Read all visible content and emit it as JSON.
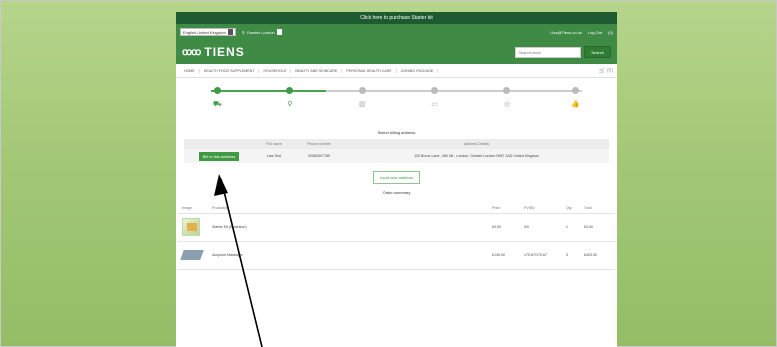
{
  "promo_bar": {
    "text": "Click here to purchase Starter kit"
  },
  "util_bar": {
    "language": "English United Kingdom",
    "region": "Greater London",
    "email": "Lisa@Tiens.co.uk",
    "logout": "Log Out",
    "cart_count": "(0)"
  },
  "header": {
    "brand": "TIENS",
    "search_placeholder": "Search store",
    "search_button": "Search"
  },
  "nav": {
    "items": [
      "HOME",
      "HEALTH FOOD SUPPLEMENT",
      "HOUSEHOLD",
      "BEAUTY AND SKINCARE",
      "PERSONAL HEALTH CARE",
      "JOINING PACKAGE"
    ],
    "cart_label": "(0)"
  },
  "checkout_steps": [
    {
      "icon": "cart-icon",
      "glyph": "⛟",
      "done": true
    },
    {
      "icon": "map-pin-icon",
      "glyph": "⚲",
      "done": true
    },
    {
      "icon": "shipping-icon",
      "glyph": "▥",
      "done": false
    },
    {
      "icon": "payment-icon",
      "glyph": "▭",
      "done": false
    },
    {
      "icon": "confirm-icon",
      "glyph": "◎",
      "done": false
    },
    {
      "icon": "thumbs-up-icon",
      "glyph": "👍",
      "done": false
    }
  ],
  "billing": {
    "title": "Select billing address",
    "headers": {
      "full_name": "Full name",
      "phone": "Phone number",
      "address": "Address Details"
    },
    "row": {
      "button": "Bill to this address",
      "full_name": "Lisa Test",
      "phone": "02082007789",
      "address": "120 Burns Lane , Mill hill , London, Greater London NW7 2AD United Kingdom"
    },
    "new_address_button": "Input new address"
  },
  "order": {
    "title": "Order summary",
    "headers": [
      "Image",
      "Product(s)",
      "Price",
      "PV/BV",
      "Qty",
      "Total"
    ],
    "rows": [
      {
        "product": "Starter Kit (E-version)",
        "price": "£0.00",
        "pvbv": "0/0",
        "qty": "1",
        "total": "£0.00"
      },
      {
        "product": "Acupoint Massager",
        "price": "£140.00",
        "pvbv": "170.67/170.67",
        "qty": "3",
        "total": "£420.00"
      }
    ]
  },
  "colors": {
    "brand_green": "#3f8a45",
    "accent_green": "#3f9a43",
    "promo_dark": "#1e5a2f"
  }
}
